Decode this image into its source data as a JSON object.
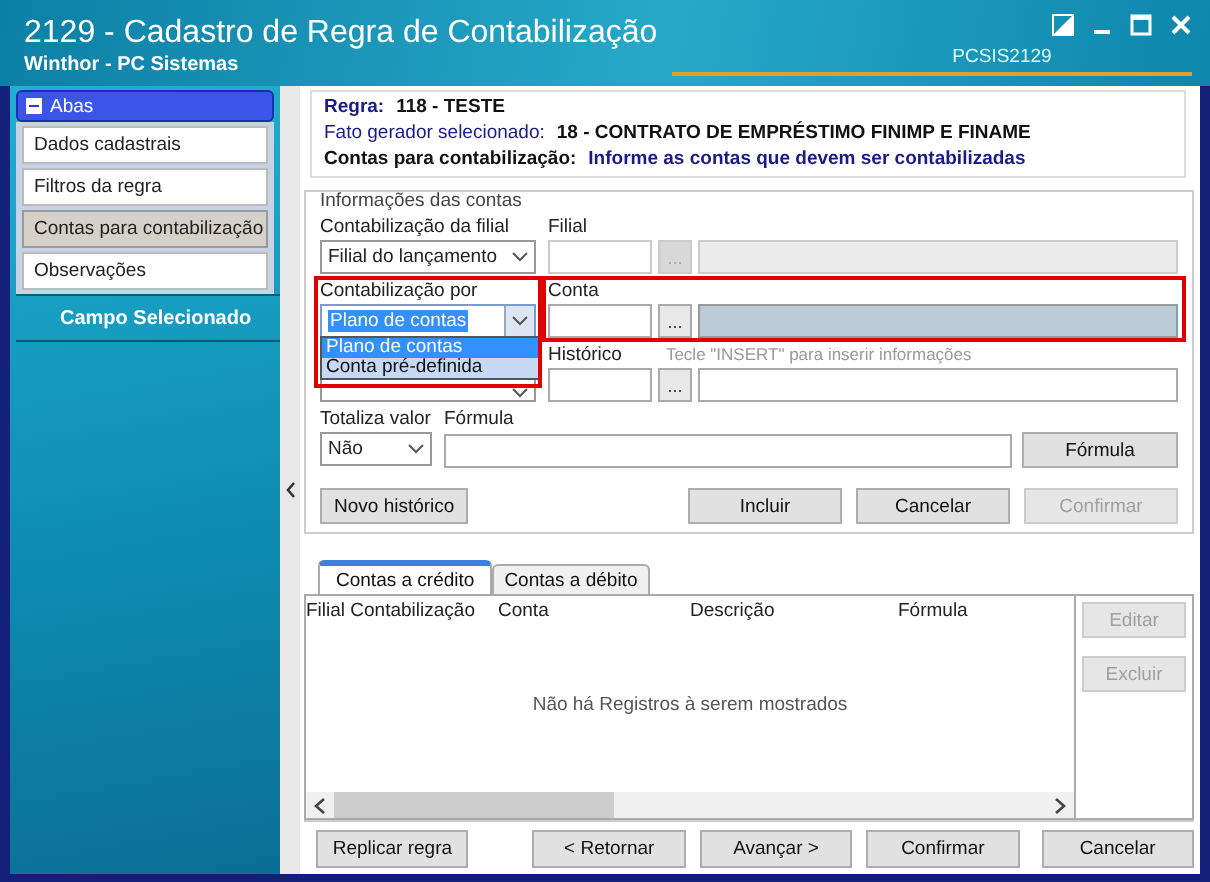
{
  "window": {
    "title": "2129 - Cadastro de Regra de Contabilização",
    "subtitle": "Winthor - PC Sistemas",
    "code": "PCSIS2129"
  },
  "sidebar": {
    "section": {
      "label": "Abas",
      "expanded": true
    },
    "items": [
      {
        "label": "Dados cadastrais",
        "selected": false
      },
      {
        "label": "Filtros da regra",
        "selected": false
      },
      {
        "label": "Contas para contabilização",
        "selected": true
      },
      {
        "label": "Observações",
        "selected": false
      }
    ],
    "panel_title": "Campo Selecionado"
  },
  "header": [
    {
      "kind": "rule",
      "label": "Regra:",
      "value": "118 - TESTE"
    },
    {
      "kind": "trigger",
      "label": "Fato gerador selecionado:",
      "value": "18 - CONTRATO DE EMPRÉSTIMO FINIMP E FINAME"
    },
    {
      "kind": "instruction",
      "label": "Contas para contabilização:",
      "value": "Informe as contas que devem ser contabilizadas"
    }
  ],
  "account_info": {
    "legend": "Informações das contas",
    "branch_mode": {
      "label": "Contabilização da filial",
      "value": "Filial do lançamento"
    },
    "branch": {
      "label": "Filial",
      "disabled": true,
      "lookup": "..."
    },
    "posting_by": {
      "label": "Contabilização por",
      "value": "Plano de contas",
      "expanded": true,
      "highlighted": true,
      "options": [
        {
          "label": "Plano de contas",
          "selected": true
        },
        {
          "label": "Conta pré-definida",
          "selected": false
        }
      ]
    },
    "account": {
      "label": "Conta",
      "highlighted": true,
      "lookup": "..."
    },
    "history": {
      "label": "Histórico",
      "hint": "Tecle  \"INSERT\" para inserir informações",
      "lookup": "..."
    },
    "totalize": {
      "label": "Totaliza valor",
      "value": "Não"
    },
    "formula": {
      "label": "Fórmula",
      "button": "Fórmula"
    },
    "new_history": {
      "label": "Novo histórico",
      "disabled": false
    },
    "actions": [
      {
        "label": "Incluir",
        "disabled": false
      },
      {
        "label": "Cancelar",
        "disabled": false
      },
      {
        "label": "Confirmar",
        "disabled": true
      }
    ]
  },
  "tabs": [
    {
      "label": "Contas a crédito",
      "selected": true
    },
    {
      "label": "Contas a débito",
      "selected": false
    }
  ],
  "table": {
    "columns": [
      "Filial Contabilização",
      "Conta",
      "Descrição",
      "Fórmula"
    ],
    "empty_message": "Não há Registros à serem mostrados"
  },
  "side_buttons": [
    {
      "label": "Editar",
      "disabled": true
    },
    {
      "label": "Excluir",
      "disabled": true
    }
  ],
  "footer_buttons": [
    {
      "label": "Replicar regra",
      "disabled": false
    },
    {
      "label": "< Retornar",
      "disabled": false
    },
    {
      "label": "Avançar >",
      "disabled": false
    },
    {
      "label": "Confirmar",
      "disabled": false
    },
    {
      "label": "Cancelar",
      "disabled": false
    }
  ]
}
